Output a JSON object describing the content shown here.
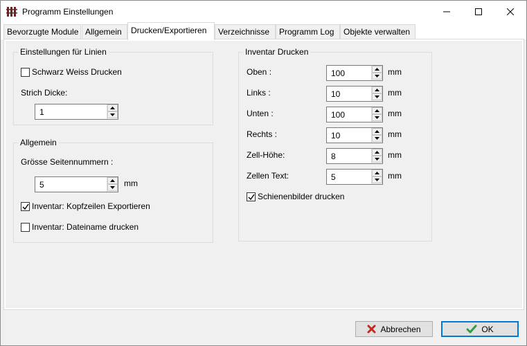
{
  "window": {
    "title": "Programm Einstellungen",
    "icon": "app-rails-icon"
  },
  "tabs": [
    {
      "label": "Bevorzugte Module",
      "active": false
    },
    {
      "label": "Allgemein",
      "active": false
    },
    {
      "label": "Drucken/Exportieren",
      "active": true
    },
    {
      "label": "Verzeichnisse",
      "active": false
    },
    {
      "label": "Programm Log",
      "active": false
    },
    {
      "label": "Objekte verwalten",
      "active": false
    }
  ],
  "lines_group": {
    "title": "Einstellungen für Linien",
    "bw_print": {
      "label": "Schwarz Weiss Drucken",
      "checked": false
    },
    "stroke_label": "Strich Dicke:",
    "stroke_value": "1"
  },
  "general_group": {
    "title": "Allgemein",
    "page_num_label": "Grösse Seitennummern :",
    "page_num_value": "5",
    "page_num_unit": "mm",
    "export_headers": {
      "label": "Inventar: Kopfzeilen Exportieren",
      "checked": true
    },
    "print_filename": {
      "label": "Inventar: Dateiname drucken",
      "checked": false
    }
  },
  "inventory_group": {
    "title": "Inventar Drucken",
    "fields": [
      {
        "label": "Oben :",
        "value": "100",
        "unit": "mm"
      },
      {
        "label": "Links :",
        "value": "10",
        "unit": "mm"
      },
      {
        "label": "Unten :",
        "value": "100",
        "unit": "mm"
      },
      {
        "label": "Rechts :",
        "value": "10",
        "unit": "mm"
      },
      {
        "label": "Zell-Höhe:",
        "value": "8",
        "unit": "mm"
      },
      {
        "label": "Zellen Text:",
        "value": "5",
        "unit": "mm"
      }
    ],
    "rail_images": {
      "label": "Schienenbilder drucken",
      "checked": true
    }
  },
  "footer": {
    "cancel_label": "Abbrechen",
    "ok_label": "OK"
  },
  "colors": {
    "accent": "#0078d7",
    "cancel_x": "#c42b1c",
    "ok_check": "#2e9e3e"
  }
}
